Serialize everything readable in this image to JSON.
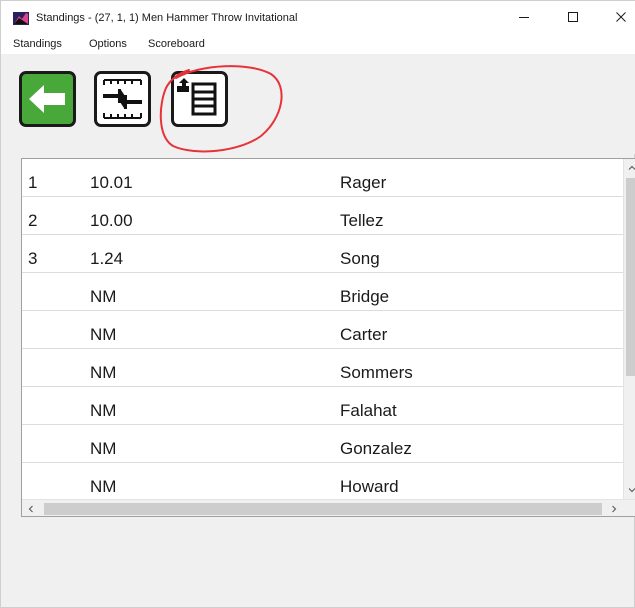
{
  "window": {
    "title": "Standings - (27, 1, 1) Men Hammer Throw Invitational"
  },
  "menu": {
    "items": [
      "Standings",
      "Options",
      "Scoreboard"
    ]
  },
  "toolbar": {
    "buttons": [
      {
        "icon": "back-arrow-icon",
        "color": "#48a83a"
      },
      {
        "icon": "sort-order-icon"
      },
      {
        "icon": "export-list-icon"
      }
    ],
    "annotation_color": "#e8323a"
  },
  "standings": {
    "columns": [
      "rank",
      "mark",
      "name"
    ],
    "rows": [
      {
        "rank": "1",
        "mark": "10.01",
        "name": "Rager"
      },
      {
        "rank": "2",
        "mark": "10.00",
        "name": "Tellez"
      },
      {
        "rank": "3",
        "mark": "1.24",
        "name": "Song"
      },
      {
        "rank": "",
        "mark": "NM",
        "name": "Bridge"
      },
      {
        "rank": "",
        "mark": "NM",
        "name": "Carter"
      },
      {
        "rank": "",
        "mark": "NM",
        "name": "Sommers"
      },
      {
        "rank": "",
        "mark": "NM",
        "name": "Falahat"
      },
      {
        "rank": "",
        "mark": "NM",
        "name": "Gonzalez"
      },
      {
        "rank": "",
        "mark": "NM",
        "name": "Howard"
      }
    ]
  }
}
